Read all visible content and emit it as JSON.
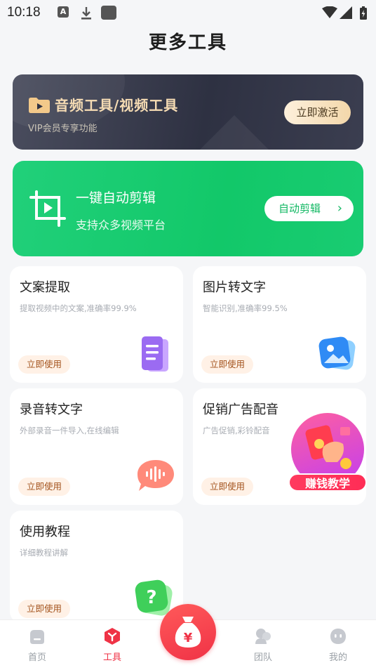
{
  "status_bar": {
    "time": "10:18",
    "a_badge": "A"
  },
  "page": {
    "title": "更多工具"
  },
  "vip_banner": {
    "title": "音频工具/视频工具",
    "subtitle": "VIP会员专享功能",
    "button": "立即激活"
  },
  "auto_banner": {
    "title": "一键自动剪辑",
    "subtitle": "支持众多视频平台",
    "button": "自动剪辑",
    "chevron": "›"
  },
  "tools": [
    {
      "title": "文案提取",
      "desc": "提取视频中的文案,准确率99.9%",
      "button": "立即使用",
      "icon": "document-icon"
    },
    {
      "title": "图片转文字",
      "desc": "智能识别,准确率99.5%",
      "button": "立即使用",
      "icon": "image-icon"
    },
    {
      "title": "录音转文字",
      "desc": "外部录音一件导入,在线编辑",
      "button": "立即使用",
      "icon": "audio-wave-icon"
    },
    {
      "title": "促销广告配音",
      "desc": "广告促销,彩铃配音",
      "button": "立即使用",
      "icon": "megaphone-icon"
    },
    {
      "title": "使用教程",
      "desc": "详细教程讲解",
      "button": "立即使用",
      "icon": "question-icon"
    }
  ],
  "promo": {
    "label": "赚钱教学"
  },
  "tabbar": {
    "items": [
      {
        "label": "首页",
        "active": false
      },
      {
        "label": "工具",
        "active": true
      },
      {
        "label": "团队",
        "active": false
      },
      {
        "label": "我的",
        "active": false
      }
    ],
    "center_icon": "money-bag-icon",
    "center_symbol": "¥"
  },
  "colors": {
    "accent_green": "#12c869",
    "accent_red": "#ef3346",
    "vip_gold": "#f6dcb4"
  }
}
